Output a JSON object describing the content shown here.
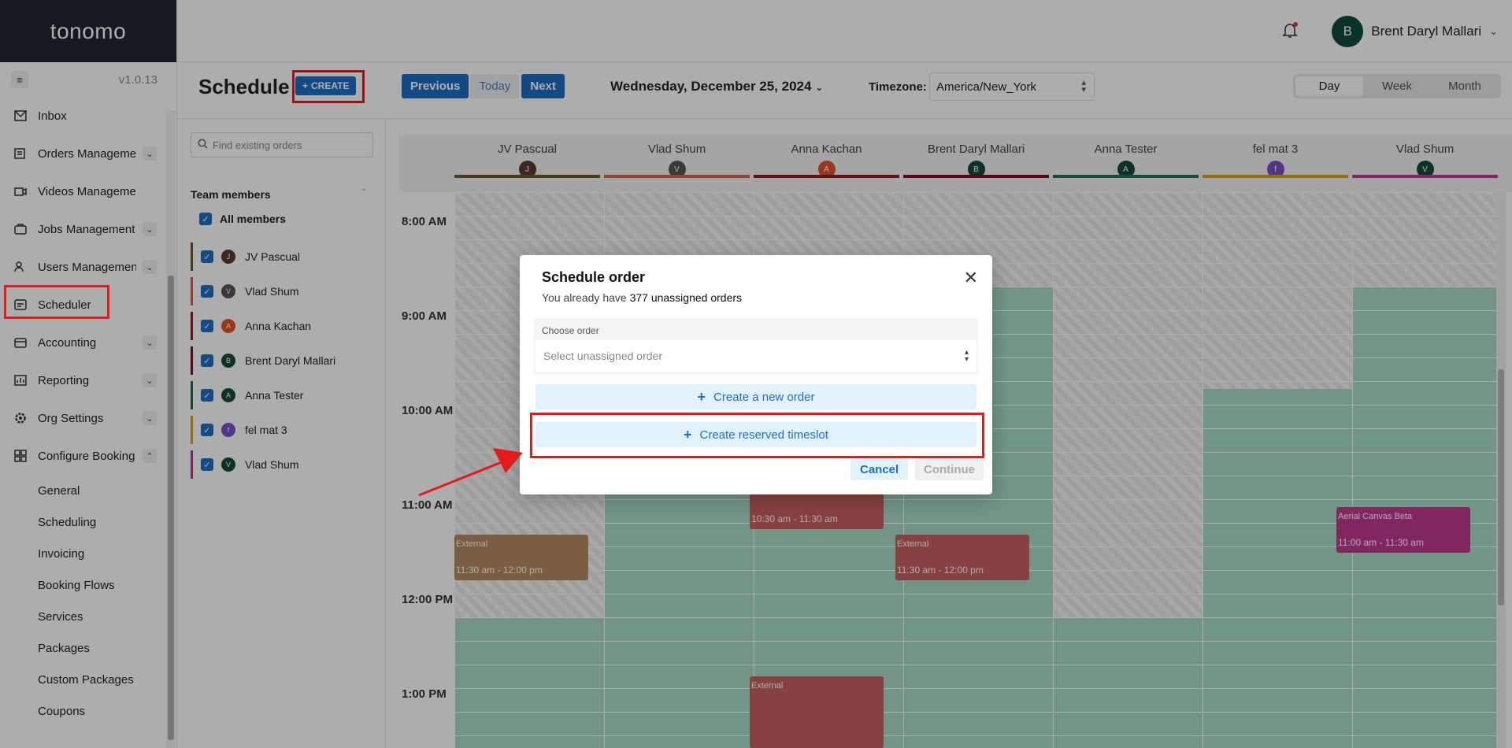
{
  "app": {
    "logo": "tonomo",
    "version": "v1.0.13"
  },
  "sidebar": {
    "items": [
      {
        "label": "Inbox",
        "icon": "inbox-icon",
        "chevron": false
      },
      {
        "label": "Orders Management",
        "icon": "orders-icon",
        "chevron": true
      },
      {
        "label": "Videos Management",
        "icon": "video-icon",
        "chevron": false
      },
      {
        "label": "Jobs Management",
        "icon": "jobs-icon",
        "chevron": true
      },
      {
        "label": "Users Management",
        "icon": "users-icon",
        "chevron": true
      },
      {
        "label": "Scheduler",
        "icon": "scheduler-icon",
        "chevron": false
      },
      {
        "label": "Accounting",
        "icon": "accounting-icon",
        "chevron": true
      },
      {
        "label": "Reporting",
        "icon": "reporting-icon",
        "chevron": true
      },
      {
        "label": "Org Settings",
        "icon": "gear-icon",
        "chevron": true
      },
      {
        "label": "Configure Booking",
        "icon": "booking-icon",
        "chevron": true
      }
    ],
    "sub_items": [
      "General",
      "Scheduling",
      "Invoicing",
      "Booking Flows",
      "Services",
      "Packages",
      "Custom Packages",
      "Coupons"
    ]
  },
  "header": {
    "user_initial": "B",
    "user_name": "Brent Daryl Mallari"
  },
  "toolbar": {
    "title": "Schedule",
    "create_label": "CREATE",
    "previous_label": "Previous",
    "today_label": "Today",
    "next_label": "Next",
    "date": "Wednesday, December 25, 2024",
    "timezone_label": "Timezone:",
    "timezone_value": "America/New_York",
    "views": [
      "Day",
      "Week",
      "Month"
    ],
    "active_view": "Day"
  },
  "left_panel": {
    "search_placeholder": "Find existing orders",
    "team_title": "Team members",
    "all_members": "All members",
    "members": [
      {
        "name": "JV Pascual",
        "initial": "J",
        "color": "#5a3b2e",
        "bar": "#6b5a22"
      },
      {
        "name": "Vlad Shum",
        "initial": "V",
        "color": "#555555",
        "bar": "#d9604a"
      },
      {
        "name": "Anna Kachan",
        "initial": "A",
        "color": "#e0532d",
        "bar": "#8a1f1f"
      },
      {
        "name": "Brent Daryl Mallari",
        "initial": "B",
        "color": "#0f4b3c",
        "bar": "#7a1020"
      },
      {
        "name": "Anna Tester",
        "initial": "A",
        "color": "#0f4b3c",
        "bar": "#1f6b5e"
      },
      {
        "name": "fel mat 3",
        "initial": "f",
        "color": "#7b4fc4",
        "bar": "#d9a21b"
      },
      {
        "name": "Vlad Shum",
        "initial": "V",
        "color": "#0f4b3c",
        "bar": "#c0398f"
      }
    ]
  },
  "calendar": {
    "times": [
      "8:00 AM",
      "9:00 AM",
      "10:00 AM",
      "11:00 AM",
      "12:00 PM",
      "1:00 PM"
    ],
    "events": [
      {
        "label": "External",
        "time": "11:30 am - 12:00 pm"
      },
      {
        "label": "",
        "time": "10:30 am - 11:30 am"
      },
      {
        "label": "External",
        "time": "11:30 am - 12:00 pm"
      },
      {
        "label": "Aerial Canvas Beta",
        "time": "11:00 am - 11:30 am"
      },
      {
        "label": "External",
        "time": ""
      }
    ]
  },
  "modal": {
    "title": "Schedule order",
    "subtitle_prefix": "You already have",
    "unassigned_count": "377 unassigned orders",
    "choose_label": "Choose order",
    "select_placeholder": "Select unassigned order",
    "create_order_label": "Create a new order",
    "reserve_label": "Create reserved timeslot",
    "cancel_label": "Cancel",
    "continue_label": "Continue"
  }
}
